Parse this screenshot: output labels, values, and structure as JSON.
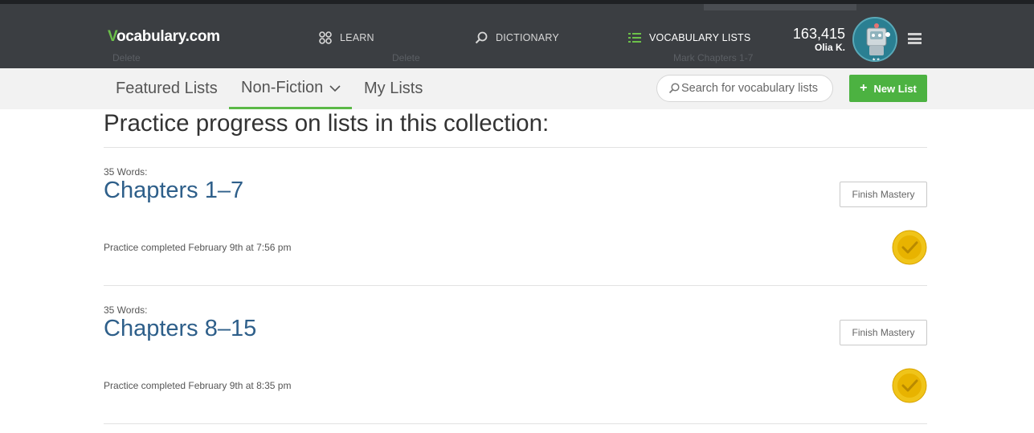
{
  "header": {
    "logo": {
      "brand_v": "V",
      "brand_rest": "ocabulary.com"
    },
    "nav": [
      {
        "label": "LEARN",
        "icon": "learn-grid-icon"
      },
      {
        "label": "DICTIONARY",
        "icon": "search-icon"
      },
      {
        "label": "VOCABULARY LISTS",
        "icon": "list-icon"
      }
    ],
    "points": "163,415",
    "user": "Olia K.",
    "ghost": {
      "left": "Delete",
      "mid": "Delete",
      "right": "Mark Chapters 1-7"
    }
  },
  "subnav": {
    "tabs": [
      {
        "label": "Featured Lists"
      },
      {
        "label": "Non-Fiction"
      },
      {
        "label": "My Lists"
      }
    ],
    "search_placeholder": "Search for vocabulary lists",
    "new_list": "New List"
  },
  "main": {
    "heading": "Practice progress on lists in this collection:",
    "lists": [
      {
        "words": "35 Words:",
        "title": "Chapters 1–7",
        "action": "Finish Mastery",
        "status": "Practice completed February 9th at 7:56 pm"
      },
      {
        "words": "35 Words:",
        "title": "Chapters 8–15",
        "action": "Finish Mastery",
        "status": "Practice completed February 9th at 8:35 pm"
      }
    ]
  },
  "colors": {
    "topbar": "#3b3e42",
    "accent_green": "#4cb241",
    "link_blue": "#2e5f8a",
    "badge_gold": "#e8b300"
  }
}
